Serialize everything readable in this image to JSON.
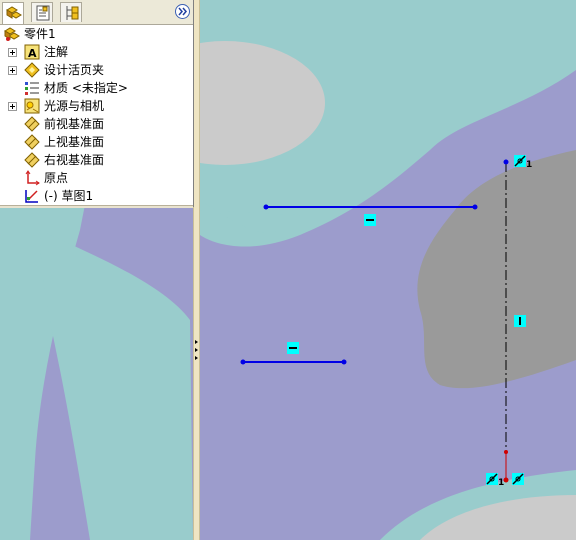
{
  "tree": {
    "root_label": "零件1",
    "items": [
      {
        "label": "注解",
        "icon": "annotation-icon",
        "expandable": true
      },
      {
        "label": "设计活页夹",
        "icon": "design-binder-icon",
        "expandable": true
      },
      {
        "label": "材质 <未指定>",
        "icon": "material-icon",
        "expandable": false
      },
      {
        "label": "光源与相机",
        "icon": "lights-cameras-icon",
        "expandable": true
      },
      {
        "label": "前视基准面",
        "icon": "plane-icon",
        "expandable": false
      },
      {
        "label": "上视基准面",
        "icon": "plane-icon",
        "expandable": false
      },
      {
        "label": "右视基准面",
        "icon": "plane-icon",
        "expandable": false
      },
      {
        "label": "原点",
        "icon": "origin-icon",
        "expandable": false
      },
      {
        "label": "(-) 草图1",
        "icon": "sketch-icon",
        "expandable": false
      }
    ]
  },
  "tabs": [
    "feature-manager-tab",
    "property-manager-tab",
    "configuration-manager-tab"
  ],
  "sketch": {
    "relation_labels": {
      "top": "1",
      "bottom": "1"
    }
  },
  "colors": {
    "background": "#9c9ccc",
    "teal": "#99cccc",
    "gray_blob": "#9a9a9a",
    "light_gray": "#cccccc",
    "sketch_line": "#0000e6",
    "relation_badge": "#00ffff"
  }
}
